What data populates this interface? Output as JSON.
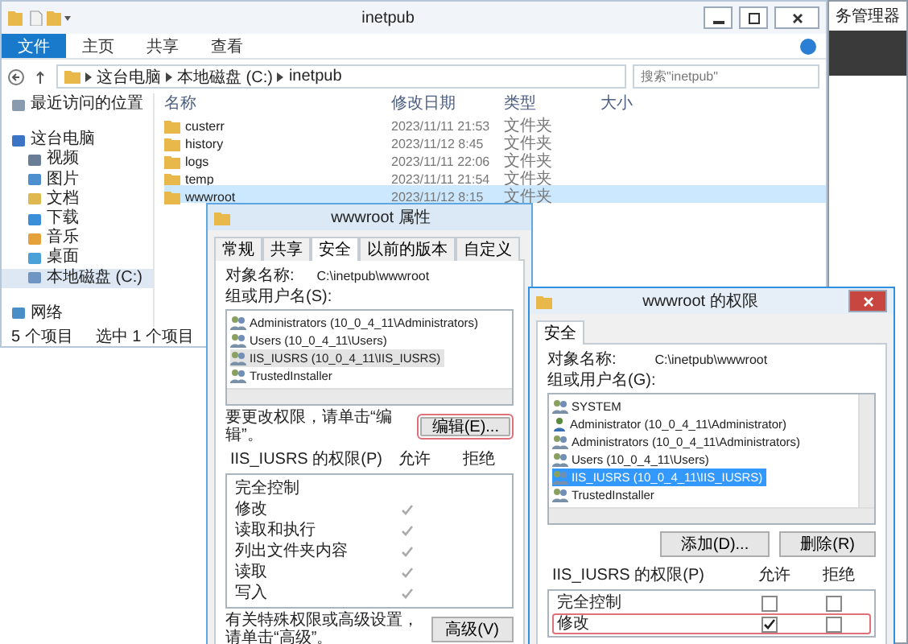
{
  "explorer": {
    "title": "inetpub",
    "ribbon_tabs": [
      {
        "label": "文件",
        "selected": true
      },
      {
        "label": "主页",
        "selected": false
      },
      {
        "label": "共享",
        "selected": false
      },
      {
        "label": "查看",
        "selected": false
      }
    ],
    "path": [
      "这台电脑",
      "本地磁盘 (C:)",
      "inetpub"
    ],
    "search": {
      "placeholder": "搜索\"inetpub\""
    },
    "nav": [
      {
        "label": "最近访问的位置",
        "kind": "recent",
        "selected": false
      },
      {
        "label": "这台电脑",
        "kind": "pc",
        "selected": false,
        "children": [
          {
            "label": "视频",
            "kind": "video",
            "selected": false
          },
          {
            "label": "图片",
            "kind": "picture",
            "selected": false
          },
          {
            "label": "文档",
            "kind": "doc",
            "selected": false
          },
          {
            "label": "下载",
            "kind": "download",
            "selected": false
          },
          {
            "label": "音乐",
            "kind": "music",
            "selected": false
          },
          {
            "label": "桌面",
            "kind": "desktop",
            "selected": false
          },
          {
            "label": "本地磁盘 (C:)",
            "kind": "drive",
            "selected": true
          }
        ]
      },
      {
        "label": "网络",
        "kind": "network",
        "selected": false
      }
    ],
    "columns": [
      "名称",
      "修改日期",
      "类型",
      "大小"
    ],
    "files": [
      {
        "name": "custerr",
        "modified": "2023/11/11 21:53",
        "type": "文件夹",
        "selected": false
      },
      {
        "name": "history",
        "modified": "2023/11/12 8:45",
        "type": "文件夹",
        "selected": false
      },
      {
        "name": "logs",
        "modified": "2023/11/11 22:06",
        "type": "文件夹",
        "selected": false
      },
      {
        "name": "temp",
        "modified": "2023/11/11 21:54",
        "type": "文件夹",
        "selected": false
      },
      {
        "name": "wwwroot",
        "modified": "2023/11/12 8:15",
        "type": "文件夹",
        "selected": true
      }
    ],
    "status": {
      "count": "5 个项目",
      "selection": "选中 1 个项目"
    }
  },
  "side_window": {
    "title": "务管理器"
  },
  "properties": {
    "title": "wwwroot 属性",
    "tabs": [
      {
        "label": "常规",
        "selected": false
      },
      {
        "label": "共享",
        "selected": false
      },
      {
        "label": "安全",
        "selected": true
      },
      {
        "label": "以前的版本",
        "selected": false
      },
      {
        "label": "自定义",
        "selected": false
      }
    ],
    "object_label": "对象名称:",
    "object_path": "C:\\inetpub\\wwwroot",
    "group_label": "组或用户名(S):",
    "principals": [
      {
        "name": "Administrators (10_0_4_11\\Administrators)",
        "kind": "group",
        "selected": false
      },
      {
        "name": "Users (10_0_4_11\\Users)",
        "kind": "group",
        "selected": false
      },
      {
        "name": "IIS_IUSRS (10_0_4_11\\IIS_IUSRS)",
        "kind": "group",
        "selected": true
      },
      {
        "name": "TrustedInstaller",
        "kind": "group",
        "selected": false
      }
    ],
    "edit_hint": "要更改权限，请单击“编辑”。",
    "edit_button": {
      "label": "编辑(E)...",
      "highlighted": true
    },
    "perm_label": "IIS_IUSRS 的权限(P)",
    "allow_label": "允许",
    "deny_label": "拒绝",
    "permissions": [
      {
        "name": "完全控制",
        "allow": false,
        "deny": false
      },
      {
        "name": "修改",
        "allow": true,
        "deny": false
      },
      {
        "name": "读取和执行",
        "allow": true,
        "deny": false
      },
      {
        "name": "列出文件夹内容",
        "allow": true,
        "deny": false
      },
      {
        "name": "读取",
        "allow": true,
        "deny": false
      },
      {
        "name": "写入",
        "allow": true,
        "deny": false
      }
    ],
    "advanced_hint": "有关特殊权限或高级设置，请单击“高级”。",
    "advanced_button": "高级(V)"
  },
  "permissions_dialog": {
    "title": "wwwroot 的权限",
    "tabs": [
      {
        "label": "安全",
        "selected": true
      }
    ],
    "object_label": "对象名称:",
    "object_path": "C:\\inetpub\\wwwroot",
    "group_label": "组或用户名(G):",
    "principals": [
      {
        "name": "SYSTEM",
        "kind": "group",
        "selected": false
      },
      {
        "name": "Administrator (10_0_4_11\\Administrator)",
        "kind": "user",
        "selected": false
      },
      {
        "name": "Administrators (10_0_4_11\\Administrators)",
        "kind": "group",
        "selected": false
      },
      {
        "name": "Users (10_0_4_11\\Users)",
        "kind": "group",
        "selected": false
      },
      {
        "name": "IIS_IUSRS (10_0_4_11\\IIS_IUSRS)",
        "kind": "group",
        "selected": true
      },
      {
        "name": "TrustedInstaller",
        "kind": "group",
        "selected": false
      }
    ],
    "buttons": [
      "添加(D)...",
      "删除(R)"
    ],
    "perm_label": "IIS_IUSRS 的权限(P)",
    "allow_label": "允许",
    "deny_label": "拒绝",
    "permissions": [
      {
        "name": "完全控制",
        "allow": false,
        "deny": false,
        "highlighted": false
      },
      {
        "name": "修改",
        "allow": true,
        "deny": false,
        "highlighted": true
      }
    ]
  }
}
